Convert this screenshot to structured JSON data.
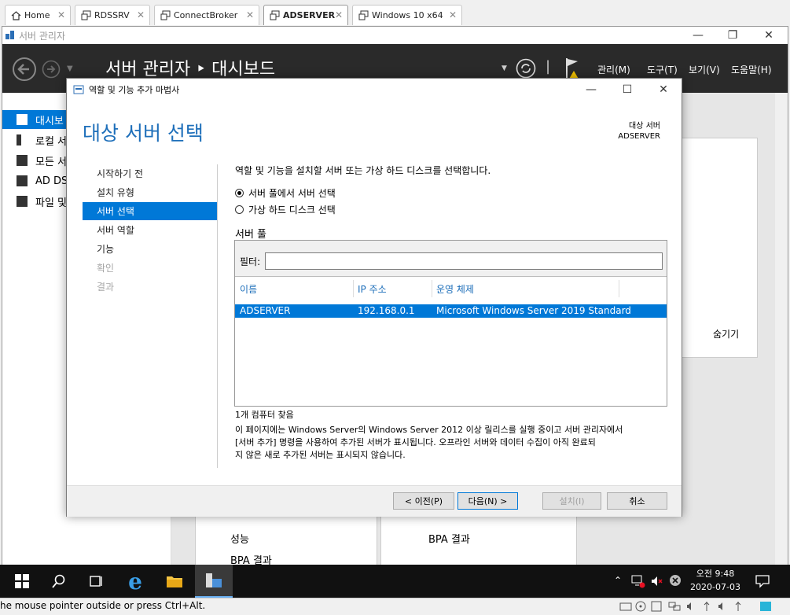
{
  "vm_tabs": [
    {
      "label": "Home",
      "icon": "home-icon"
    },
    {
      "label": "RDSSRV",
      "icon": "vm-icon"
    },
    {
      "label": "ConnectBroker",
      "icon": "vm-icon"
    },
    {
      "label": "ADSERVER",
      "icon": "vm-icon",
      "active": true
    },
    {
      "label": "Windows 10 x64",
      "icon": "vm-icon"
    }
  ],
  "server_manager": {
    "window_title": "서버 관리자",
    "breadcrumb": "서버 관리자 ‣ 대시보드",
    "menus": [
      "관리(M)",
      "도구(T)",
      "보기(V)",
      "도움말(H)"
    ],
    "nav": [
      "대시보드",
      "로컬 서버",
      "모든 서버",
      "AD DS",
      "파일 및 저장소 서비스"
    ],
    "nav_visible": [
      "대시보",
      "로컬 서",
      "모든 서",
      "AD DS",
      "파일 및"
    ],
    "hide_label": "숨기기",
    "tiles": {
      "left": [
        "성능",
        "BPA 결과"
      ],
      "right": [
        "BPA 결과"
      ]
    }
  },
  "wizard": {
    "title": "역할 및 기능 추가 마법사",
    "heading": "대상 서버 선택",
    "target_label": "대상 서버",
    "target_value": "ADSERVER",
    "steps": [
      {
        "label": "시작하기 전",
        "state": "normal"
      },
      {
        "label": "설치 유형",
        "state": "normal"
      },
      {
        "label": "서버 선택",
        "state": "selected"
      },
      {
        "label": "서버 역할",
        "state": "normal"
      },
      {
        "label": "기능",
        "state": "normal"
      },
      {
        "label": "확인",
        "state": "disabled"
      },
      {
        "label": "결과",
        "state": "disabled"
      }
    ],
    "instruction": "역할 및 기능을 설치할 서버 또는 가상 하드 디스크를 선택합니다.",
    "radio_pool": "서버 풀에서 서버 선택",
    "radio_vhd": "가상 하드 디스크 선택",
    "pool_title": "서버 풀",
    "filter_label": "필터:",
    "filter_value": "",
    "columns": [
      "이름",
      "IP 주소",
      "운영 체제"
    ],
    "rows": [
      {
        "name": "ADSERVER",
        "ip": "192.168.0.1",
        "os": "Microsoft Windows Server 2019 Standard"
      }
    ],
    "found_count": "1개 컴퓨터 찾음",
    "note_lines": [
      "이 페이지에는 Windows Server의 Windows Server 2012 이상 릴리스를 실행 중이고 서버 관리자에서",
      "[서버 추가] 명령을 사용하여 추가된 서버가 표시됩니다. 오프라인 서버와 데이터 수집이 아직 완료되",
      "지 않은 새로 추가된 서버는 표시되지 않습니다."
    ],
    "buttons": {
      "prev": "< 이전(P)",
      "next": "다음(N) >",
      "install": "설치(I)",
      "cancel": "취소"
    }
  },
  "taskbar": {
    "time": "오전 9:48",
    "date": "2020-07-03"
  },
  "status_bar": {
    "text": "he mouse pointer outside or press Ctrl+Alt."
  },
  "colors": {
    "accent": "#0078d7",
    "header": "#2a2a2a",
    "taskbar": "#111111"
  }
}
